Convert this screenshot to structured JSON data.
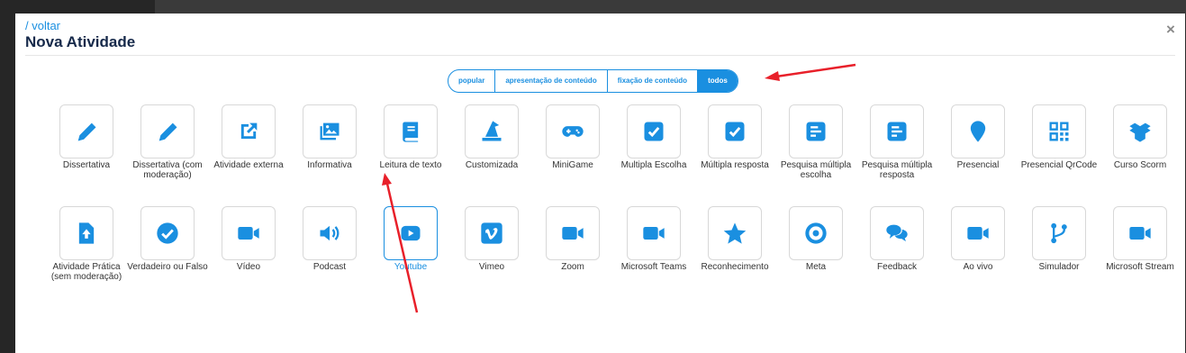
{
  "modal": {
    "back_label": "/ voltar",
    "title": "Nova Atividade",
    "close_label": "×"
  },
  "filters": [
    {
      "label": "popular",
      "active": false
    },
    {
      "label": "apresentação de conteúdo",
      "active": false
    },
    {
      "label": "fixação de conteúdo",
      "active": false
    },
    {
      "label": "todos",
      "active": true
    }
  ],
  "activities": [
    [
      {
        "label": "Dissertativa",
        "icon": "pencil-icon"
      },
      {
        "label": "Dissertativa (com moderação)",
        "icon": "pencil-icon"
      },
      {
        "label": "Atividade externa",
        "icon": "external-link-icon"
      },
      {
        "label": "Informativa",
        "icon": "images-icon"
      },
      {
        "label": "Leitura de texto",
        "icon": "book-icon"
      },
      {
        "label": "Customizada",
        "icon": "wizard-hat-icon"
      },
      {
        "label": "MiniGame",
        "icon": "gamepad-icon"
      },
      {
        "label": "Multipla Escolha",
        "icon": "checkbox-icon"
      },
      {
        "label": "Múltipla resposta",
        "icon": "checkbox-icon"
      },
      {
        "label": "Pesquisa múltipla escolha",
        "icon": "poll-icon"
      },
      {
        "label": "Pesquisa múltipla resposta",
        "icon": "poll-icon"
      },
      {
        "label": "Presencial",
        "icon": "map-pin-icon"
      },
      {
        "label": "Presencial QrCode",
        "icon": "qrcode-icon"
      },
      {
        "label": "Curso Scorm",
        "icon": "box-open-icon"
      }
    ],
    [
      {
        "label": "Atividade Prática (sem moderação)",
        "icon": "file-upload-icon"
      },
      {
        "label": "Verdadeiro ou Falso",
        "icon": "check-circle-icon"
      },
      {
        "label": "Vídeo",
        "icon": "video-camera-icon"
      },
      {
        "label": "Podcast",
        "icon": "volume-icon"
      },
      {
        "label": "Youtube",
        "icon": "youtube-icon",
        "selected": true
      },
      {
        "label": "Vimeo",
        "icon": "vimeo-icon"
      },
      {
        "label": "Zoom",
        "icon": "video-camera-icon"
      },
      {
        "label": "Microsoft Teams",
        "icon": "video-camera-icon"
      },
      {
        "label": "Reconhecimento",
        "icon": "star-icon"
      },
      {
        "label": "Meta",
        "icon": "target-icon"
      },
      {
        "label": "Feedback",
        "icon": "comments-icon"
      },
      {
        "label": "Ao vivo",
        "icon": "video-camera-icon"
      },
      {
        "label": "Simulador",
        "icon": "code-branch-icon"
      },
      {
        "label": "Microsoft Stream",
        "icon": "video-camera-icon"
      }
    ]
  ],
  "colors": {
    "accent": "#1a8fe0",
    "title": "#16294a",
    "annotation_arrow": "#e8202a"
  }
}
